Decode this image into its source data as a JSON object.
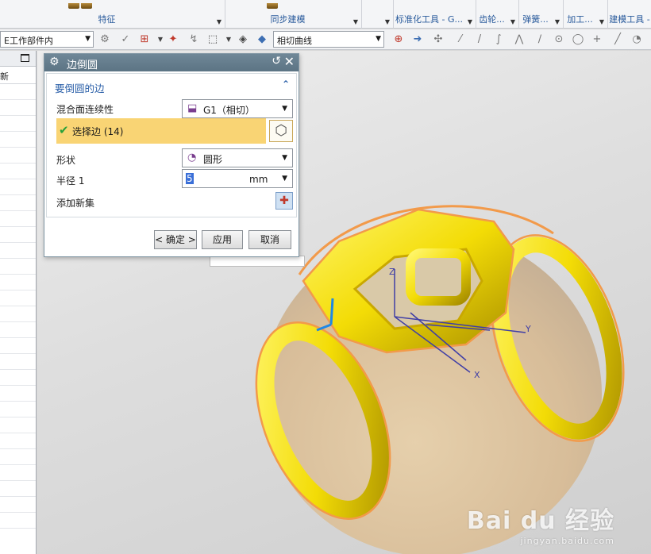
{
  "ribbon": {
    "groups": [
      {
        "label": "特征"
      },
      {
        "label": "同步建模"
      },
      {
        "label": "标准化工具 - G..."
      },
      {
        "label": "齿轮..."
      },
      {
        "label": "弹簧..."
      },
      {
        "label": "加工..."
      },
      {
        "label": "建模工具 -"
      }
    ]
  },
  "toolbar": {
    "scope_combo": "E工作部件内",
    "curve_rule_combo": "相切曲线"
  },
  "navigator": {
    "column_label": "新"
  },
  "dialog": {
    "title": "边倒圆",
    "section_title": "要倒圆的边",
    "continuity_label": "混合面连续性",
    "continuity_value": "G1（相切）",
    "select_edge_label": "选择边 (14)",
    "shape_label": "形状",
    "shape_value": "圆形",
    "radius_label": "半径 1",
    "radius_value": "5",
    "radius_unit": "mm",
    "add_set_label": "添加新集",
    "ok_label": "< 确定 >",
    "apply_label": "应用",
    "cancel_label": "取消"
  },
  "viewport": {
    "axis_x": "X",
    "axis_y": "Y",
    "axis_z": "Z"
  },
  "watermark": {
    "main": "Bai du 经验",
    "sub": "jingyan.baidu.com"
  },
  "colors": {
    "model_yellow": "#f5e20a",
    "edge_orange": "#f29a4a",
    "sphere_tan": "#d9bf9a",
    "dialog_title": "#5f7787",
    "selection_row": "#f9d474"
  }
}
